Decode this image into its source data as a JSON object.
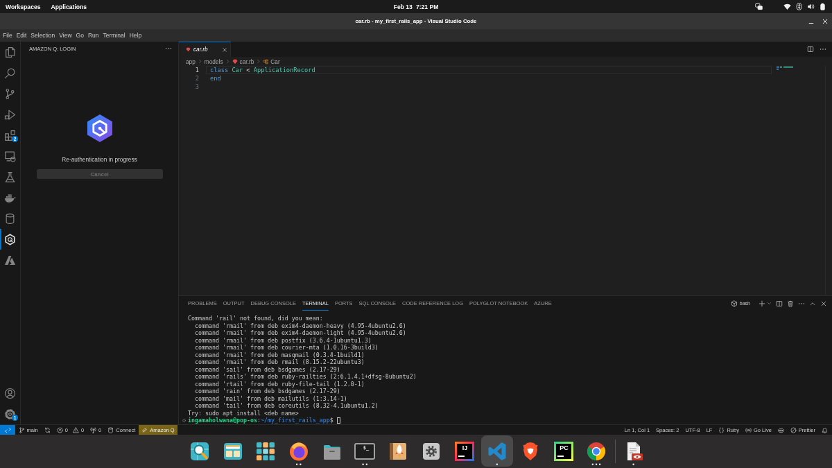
{
  "top_bar": {
    "menus": [
      "Workspaces",
      "Applications"
    ],
    "date": "Feb 13",
    "time": "7:21 PM"
  },
  "window": {
    "title": "car.rb - my_first_rails_app - Visual Studio Code"
  },
  "menu": [
    "File",
    "Edit",
    "Selection",
    "View",
    "Go",
    "Run",
    "Terminal",
    "Help"
  ],
  "activity_bar": {
    "items": [
      {
        "kind": "explorer",
        "selected": false
      },
      {
        "kind": "search",
        "selected": false
      },
      {
        "kind": "source-control",
        "selected": false
      },
      {
        "kind": "run-debug",
        "selected": false
      },
      {
        "kind": "extensions",
        "selected": false,
        "badge": "2"
      },
      {
        "kind": "remote",
        "selected": false
      },
      {
        "kind": "testing",
        "selected": false
      },
      {
        "kind": "docker",
        "selected": false
      },
      {
        "kind": "database",
        "selected": false
      },
      {
        "kind": "amazon-q",
        "selected": true
      },
      {
        "kind": "azure",
        "selected": false
      }
    ],
    "bottom": [
      {
        "kind": "account"
      },
      {
        "kind": "settings",
        "badge": "1"
      }
    ]
  },
  "sidebar": {
    "title": "AMAZON Q: LOGIN",
    "message": "Re-authentication in progress",
    "cancel_button": {
      "label": "Cancel",
      "disabled": true
    }
  },
  "editor": {
    "tabs": [
      {
        "label": "car.rb",
        "selected": true,
        "preview": true
      }
    ],
    "breadcrumbs": [
      {
        "kind": "folder",
        "label": "app"
      },
      {
        "kind": "folder",
        "label": "models"
      },
      {
        "kind": "file",
        "label": "car.rb"
      },
      {
        "kind": "symbol",
        "label": "Car"
      }
    ],
    "lines": [
      {
        "number": "1",
        "current": true,
        "tokens": [
          {
            "kind": "keyword",
            "text": "class"
          },
          {
            "kind": "type",
            "text": "Car"
          },
          {
            "kind": "plain",
            "text": "<"
          },
          {
            "kind": "type",
            "text": "ApplicationRecord"
          }
        ]
      },
      {
        "number": "2",
        "current": false,
        "tokens": [
          {
            "kind": "keyword",
            "text": "end"
          }
        ]
      },
      {
        "number": "3",
        "current": false
      }
    ]
  },
  "panel": {
    "tabs": [
      {
        "label": "PROBLEMS",
        "selected": false
      },
      {
        "label": "OUTPUT",
        "selected": false
      },
      {
        "label": "DEBUG CONSOLE",
        "selected": false
      },
      {
        "label": "TERMINAL",
        "selected": true
      },
      {
        "label": "PORTS",
        "selected": false
      },
      {
        "label": "SQL CONSOLE",
        "selected": false
      },
      {
        "label": "CODE REFERENCE LOG",
        "selected": false
      },
      {
        "label": "POLYGLOT NOTEBOOK",
        "selected": false
      },
      {
        "label": "AZURE",
        "selected": false
      }
    ],
    "terminal": {
      "shell": "bash",
      "lines": [
        {
          "text": "Command 'rail' not found, did you mean:",
          "children": [
            {
              "text": "command 'rmail' from deb exim4-daemon-heavy (4.95-4ubuntu2.6)"
            },
            {
              "text": "command 'rmail' from deb exim4-daemon-light (4.95-4ubuntu2.6)"
            },
            {
              "text": "command 'rmail' from deb postfix (3.6.4-1ubuntu1.3)"
            },
            {
              "text": "command 'rmail' from deb courier-mta (1.0.16-3build3)"
            },
            {
              "text": "command 'rmail' from deb masqmail (0.3.4-1build1)"
            },
            {
              "text": "command 'rmail' from deb rmail (8.15.2-22ubuntu3)"
            },
            {
              "text": "command 'sail' from deb bsdgames (2.17-29)"
            },
            {
              "text": "command 'rails' from deb ruby-railties (2:6.1.4.1+dfsg-8ubuntu2)"
            },
            {
              "text": "command 'rtail' from deb ruby-file-tail (1.2.0-1)"
            },
            {
              "text": "command 'rain' from deb bsdgames (2.17-29)"
            },
            {
              "text": "command 'mail' from deb mailutils (1:3.14-1)"
            },
            {
              "text": "command 'tail' from deb coreutils (8.32-4.1ubuntu1.2)"
            }
          ]
        },
        {
          "text": "Try: sudo apt install <deb name>"
        }
      ],
      "prompt": {
        "user": "ingamaholwana@pop-os",
        "separator": ":",
        "path": "~/my_first_rails_app",
        "symbol": "$"
      }
    }
  },
  "status_bar": {
    "left": [
      {
        "kind": "remote",
        "highlighted": false
      },
      {
        "kind": "branch",
        "text": "main",
        "highlighted": false
      },
      {
        "kind": "sync",
        "highlighted": false
      },
      {
        "kind": "problems",
        "errors": "0",
        "warnings": "0",
        "highlighted": false
      },
      {
        "kind": "ports",
        "text": "0",
        "highlighted": false
      },
      {
        "kind": "connect",
        "text": "Connect",
        "highlighted": false
      },
      {
        "kind": "amazon-q",
        "text": "Amazon Q",
        "highlighted": true
      }
    ],
    "right": [
      {
        "kind": "cursor",
        "text": "Ln 1, Col 1"
      },
      {
        "kind": "indent",
        "text": "Spaces: 2"
      },
      {
        "kind": "encoding",
        "text": "UTF-8"
      },
      {
        "kind": "eol",
        "text": "LF"
      },
      {
        "kind": "language",
        "text": "Ruby"
      },
      {
        "kind": "live",
        "text": "Go Live"
      },
      {
        "kind": "assistant"
      },
      {
        "kind": "formatter",
        "text": "Prettier"
      },
      {
        "kind": "notifications"
      }
    ]
  },
  "dock": {
    "apps": [
      {
        "kind": "shop",
        "selected": false
      },
      {
        "kind": "tiles",
        "selected": false
      },
      {
        "kind": "grid",
        "selected": false
      },
      {
        "kind": "fox",
        "selected": false,
        "indicator": "••"
      },
      {
        "kind": "files",
        "selected": false
      },
      {
        "kind": "terminal",
        "glyph": "$_",
        "selected": false,
        "indicator": "••"
      },
      {
        "kind": "rocket",
        "selected": false
      },
      {
        "kind": "settings",
        "selected": false
      },
      {
        "kind": "ide-violet",
        "glyph": "IJ",
        "selected": false
      },
      {
        "kind": "code",
        "selected": true,
        "indicator": "•"
      },
      {
        "kind": "lion",
        "selected": false
      },
      {
        "kind": "ide-lime",
        "glyph": "PC",
        "selected": false
      },
      {
        "kind": "wheel",
        "selected": false,
        "indicator": "•••"
      }
    ],
    "end": [
      {
        "kind": "document",
        "selected": false,
        "indicator": "•"
      }
    ]
  }
}
